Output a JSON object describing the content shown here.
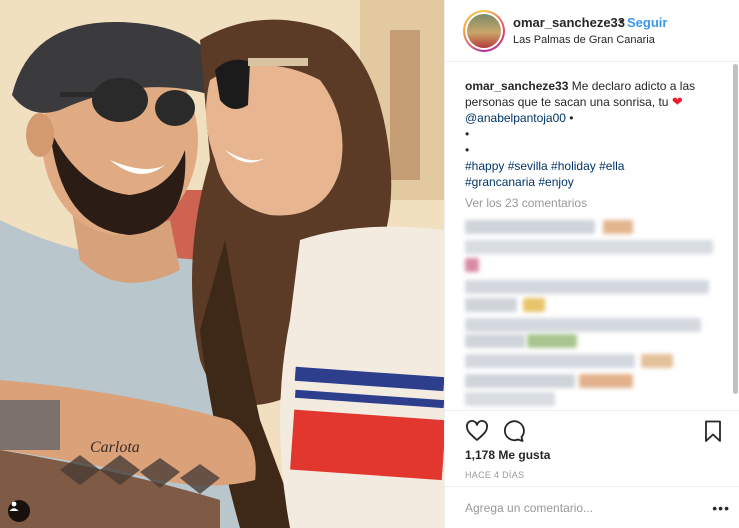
{
  "post": {
    "username": "omar_sancheze33",
    "separator": "•",
    "follow_label": "Seguir",
    "location": "Las Palmas de Gran Canaria"
  },
  "caption": {
    "username": "omar_sancheze33",
    "text": "Me declaro adicto a las personas que te sacan una sonrisa, tu",
    "heart_icon": "red-heart-emoji",
    "mention": "@anabelpantoja00",
    "bullet": "•",
    "hashtags_line1": "#happy #sevilla #holiday #ella",
    "hashtags_line2": "#grancanaria #enjoy"
  },
  "comments": {
    "view_all_label": "Ver los 23 comentarios"
  },
  "engagement": {
    "likes_label": "1,178 Me gusta",
    "timestamp": "HACE 4 DÍAS"
  },
  "add_comment": {
    "placeholder": "Agrega un comentario...",
    "more_label": "•••"
  },
  "photo": {
    "tattoo_text": "Carlota"
  },
  "icons": {
    "like": "heart-outline-icon",
    "comment": "comment-bubble-icon",
    "save": "bookmark-icon",
    "user_tag": "user-tag-icon"
  },
  "colors": {
    "link": "#003569",
    "follow": "#3897f0",
    "heart": "#ed1c2e",
    "muted": "#999999"
  }
}
